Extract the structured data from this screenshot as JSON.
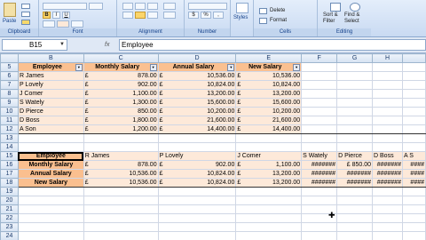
{
  "ribbon": {
    "clipboard": {
      "paste_label": "Paste",
      "group_label": "Clipboard"
    },
    "font": {
      "bold": "B",
      "italic": "I",
      "underline": "U",
      "group_label": "Font"
    },
    "alignment": {
      "group_label": "Alignment"
    },
    "number": {
      "format_symbol": "$",
      "percent": "%",
      "comma": ",",
      "group_label": "Number"
    },
    "styles": {
      "label": "Styles"
    },
    "cells": {
      "delete_label": "Delete",
      "format_label": "Format",
      "group_label": "Cells"
    },
    "editing": {
      "sort_label": "Sort &",
      "filter_label": "Filter",
      "find_label": "Find &",
      "select_label": "Select",
      "group_label": "Editing"
    }
  },
  "formula_bar": {
    "name_box": "B15",
    "fx_label": "fx",
    "content": "Employee"
  },
  "grid": {
    "column_headers": [
      "B",
      "C",
      "D",
      "E",
      "F",
      "G",
      "H"
    ],
    "row_numbers": [
      "5",
      "6",
      "7",
      "8",
      "9",
      "10",
      "11",
      "12",
      "13",
      "14",
      "15",
      "16",
      "17",
      "18",
      "19",
      "20",
      "21",
      "22",
      "23",
      "24"
    ],
    "table1": {
      "headers": [
        "Employee",
        "Monthly Salary",
        "Annual Salary",
        "New Salary"
      ],
      "rows": [
        {
          "name": "R James",
          "monthly": "878.00",
          "annual": "10,536.00",
          "new": "10,536.00"
        },
        {
          "name": "P Lovely",
          "monthly": "902.00",
          "annual": "10,824.00",
          "new": "10,824.00"
        },
        {
          "name": "J Comer",
          "monthly": "1,100.00",
          "annual": "13,200.00",
          "new": "13,200.00"
        },
        {
          "name": "S Wately",
          "monthly": "1,300.00",
          "annual": "15,600.00",
          "new": "15,600.00"
        },
        {
          "name": "D Pierce",
          "monthly": "850.00",
          "annual": "10,200.00",
          "new": "10,200.00"
        },
        {
          "name": "D Boss",
          "monthly": "1,800.00",
          "annual": "21,600.00",
          "new": "21,600.00"
        },
        {
          "name": "A Son",
          "monthly": "1,200.00",
          "annual": "14,400.00",
          "new": "14,400.00"
        }
      ],
      "currency": "£"
    },
    "table2": {
      "header_label": "Employee",
      "names": [
        "R James",
        "P Lovely",
        "J Comer",
        "S Wately",
        "D Pierce",
        "D Boss",
        "A S"
      ],
      "rows": [
        {
          "label": "Monthly Salary",
          "values": [
            "878.00",
            "902.00",
            "1,100.00",
            "#######",
            "£ 850.00",
            "#######",
            "####"
          ]
        },
        {
          "label": "Annual Salary",
          "values": [
            "10,536.00",
            "10,824.00",
            "13,200.00",
            "#######",
            "#######",
            "#######",
            "####"
          ]
        },
        {
          "label": "New Salary",
          "values": [
            "10,536.00",
            "10,824.00",
            "13,200.00",
            "#######",
            "#######",
            "#######",
            "####"
          ]
        }
      ]
    }
  }
}
